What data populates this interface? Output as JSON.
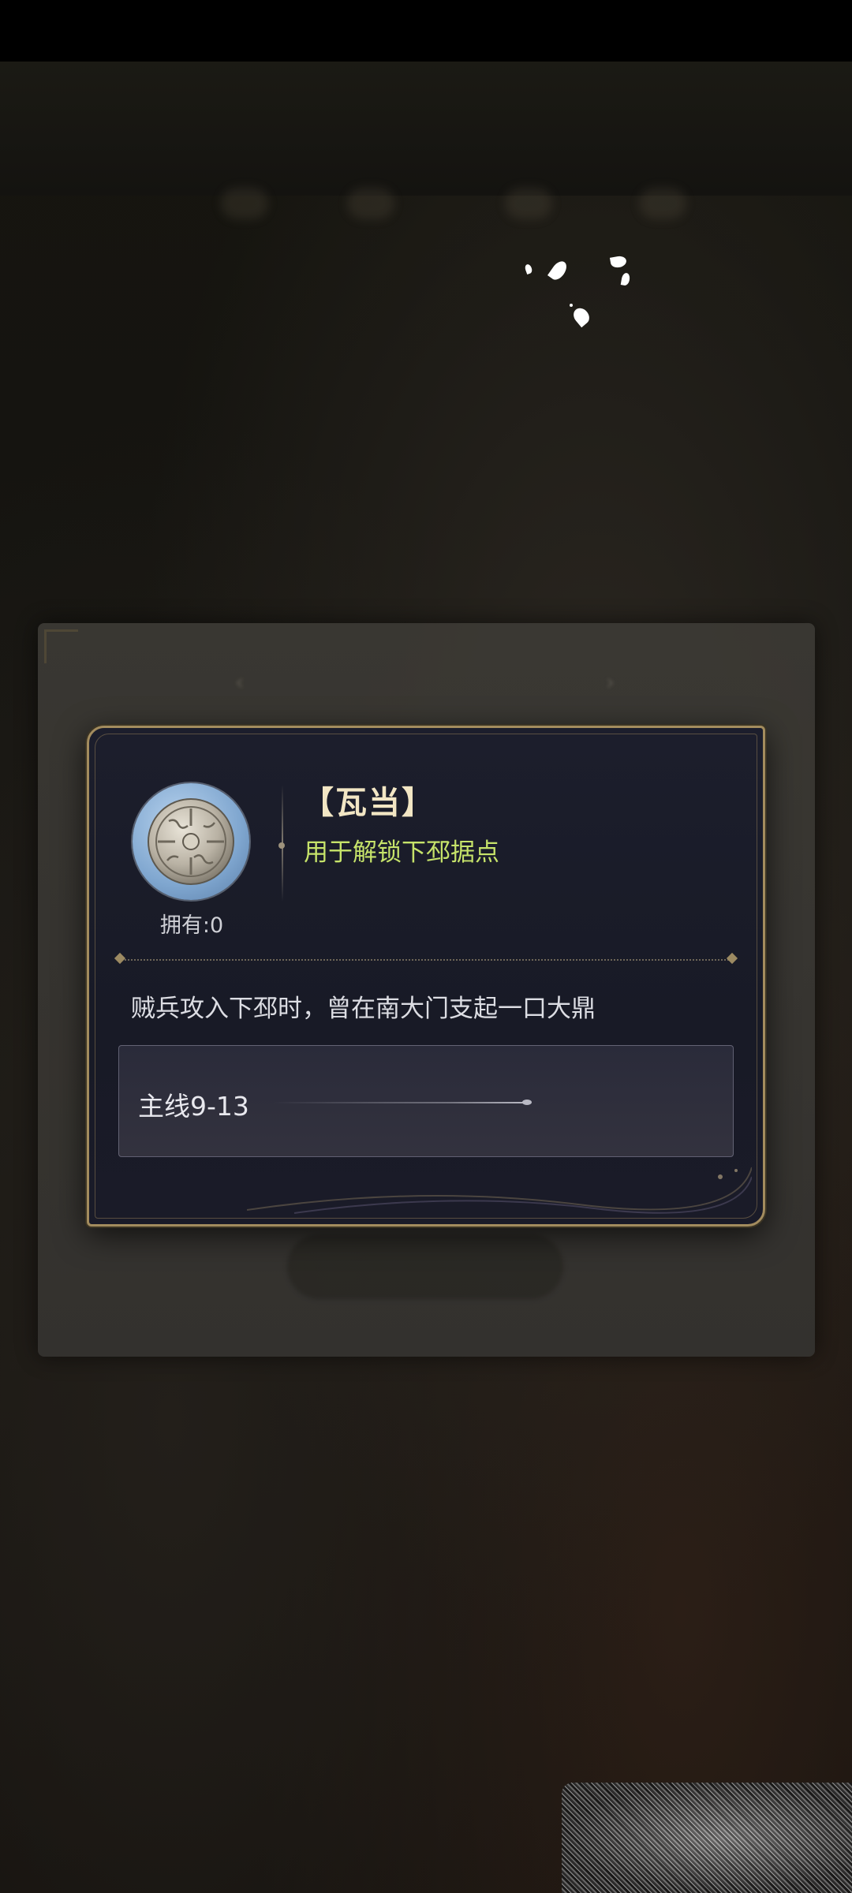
{
  "item": {
    "name": "【瓦当】",
    "use": "用于解锁下邳据点",
    "owned": "拥有:0",
    "description": "贼兵攻入下邳时，曾在南大门支起一口大鼎",
    "source": "主线9-13",
    "icon": "roof-tile-disc-icon"
  },
  "colors": {
    "card_bg": "#1c1e2c",
    "card_border": "#a38c5e",
    "name_text": "#f2e6c4",
    "use_text": "#c6e36a",
    "body_text": "#dcdde3"
  }
}
